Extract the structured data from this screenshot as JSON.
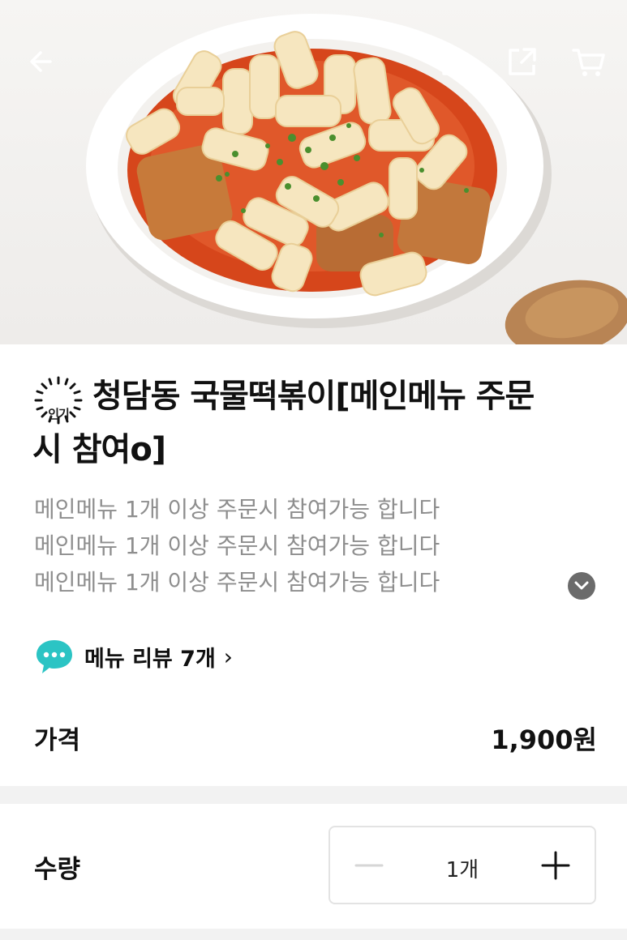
{
  "header": {
    "back_icon": "arrow-left-icon",
    "home_icon": "home-icon",
    "share_icon": "share-icon",
    "cart_icon": "cart-icon"
  },
  "product": {
    "badge": "인기",
    "title_line1": "청담동 국물떡볶이[메인메뉴 주문",
    "title_line2": "시 참여o]",
    "description": [
      "메인메뉴 1개 이상 주문시 참여가능 합니다",
      "메인메뉴 1개 이상 주문시 참여가능 합니다",
      "메인메뉴 1개 이상 주문시 참여가능 합니다"
    ],
    "expand_icon": "chevron-down-icon"
  },
  "review": {
    "icon": "speech-bubble-icon",
    "label": "메뉴 리뷰 7개",
    "chevron": "›"
  },
  "price": {
    "label": "가격",
    "value": "1,900원"
  },
  "quantity": {
    "label": "수량",
    "value": "1개"
  },
  "colors": {
    "accent_bubble": "#2bc4c4",
    "text_primary": "#111111",
    "text_secondary": "#8e8e8e"
  }
}
